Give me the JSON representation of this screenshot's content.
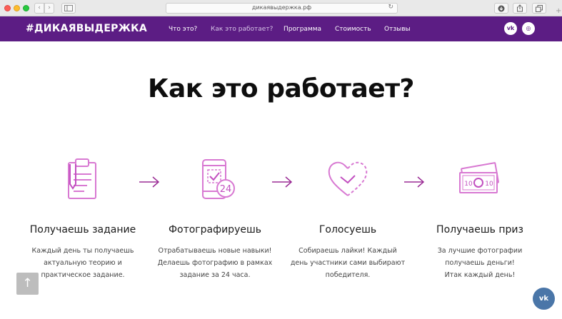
{
  "browser": {
    "url": "дикаявыдержка.рф",
    "back_glyph": "‹",
    "forward_glyph": "›",
    "reload_glyph": "↻",
    "new_tab_glyph": "+"
  },
  "navbar": {
    "logo": "#ДИКАЯВЫДЕРЖКА",
    "items": [
      {
        "label": "Что это?"
      },
      {
        "label": "Как это работает?"
      },
      {
        "label": "Программа"
      },
      {
        "label": "Стоимость"
      },
      {
        "label": "Отзывы"
      }
    ],
    "active_index": 1,
    "background": "#5c1d84"
  },
  "headline": "Как это работает?",
  "steps": [
    {
      "icon": "clipboard-task-icon",
      "title": "Получаешь задание",
      "desc_lines": [
        "Каждый день ты получаешь",
        "актуальную теорию и",
        "практическое задание."
      ]
    },
    {
      "icon": "phone-24-icon",
      "title": "Фотографируешь",
      "desc_lines": [
        "Отрабатываешь новые навыки!",
        "Делаешь фотографию в рамках",
        "задание за 24 часа."
      ]
    },
    {
      "icon": "heart-vote-icon",
      "title": "Голосуешь",
      "desc_lines": [
        "Собираешь лайки! Каждый",
        "день участники сами выбирают",
        "победителя."
      ]
    },
    {
      "icon": "money-prize-icon",
      "title": "Получаешь приз",
      "desc_lines": [
        "За лучшие фотографии",
        "получаешь деньги!",
        "Итак каждый день!"
      ]
    }
  ],
  "phone_icon_badge": "24",
  "money_icon_labels": [
    "10",
    "10"
  ],
  "social_icons": [
    "vk-icon",
    "instagram-icon"
  ],
  "social_labels": {
    "vk": "vk",
    "ig": "◎"
  },
  "floating": {
    "scroll_top_glyph": "↑",
    "vk_label": "vk"
  },
  "colors": {
    "accent": "#5c1d84",
    "icon_stroke": "#d879d2",
    "icon_stroke_dark": "#c24fc0",
    "arrow": "#9b2d95",
    "vk_blue": "#4a76a8"
  }
}
